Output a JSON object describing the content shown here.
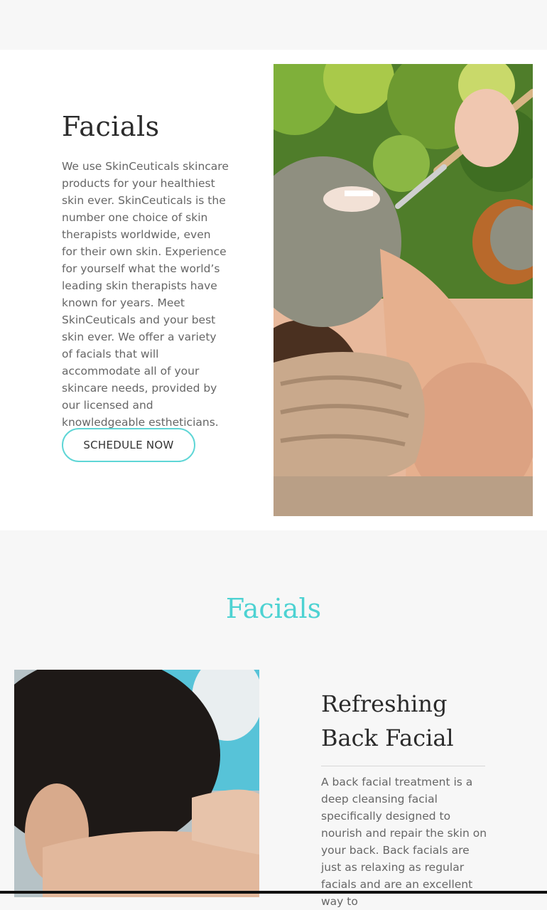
{
  "hero": {
    "title": "Facials",
    "body": "We use SkinCeuticals skincare products for your healthiest skin ever. SkinCeuticals is the number one choice of skin therapists worldwide, even for their own skin. Experience for yourself what the world’s leading skin therapists have known for years. Meet SkinCeuticals and your best skin ever. We offer a variety of facials that will accommodate all of your skincare needs, provided by our licensed and knowledgeable estheticians.",
    "cta_label": "SCHEDULE NOW"
  },
  "services": {
    "heading": "Facials",
    "card": {
      "title": "Refreshing Back Facial",
      "body": "A back facial treatment is a deep cleansing facial specifically designed to nourish and repair the skin on your back. Back facials are just as relaxing as regular facials and are an excellent way to"
    }
  },
  "colors": {
    "accent": "#4dd2d2",
    "button_border": "#5fd6d6",
    "body_text": "#666666",
    "heading_text": "#2b2b2b"
  }
}
